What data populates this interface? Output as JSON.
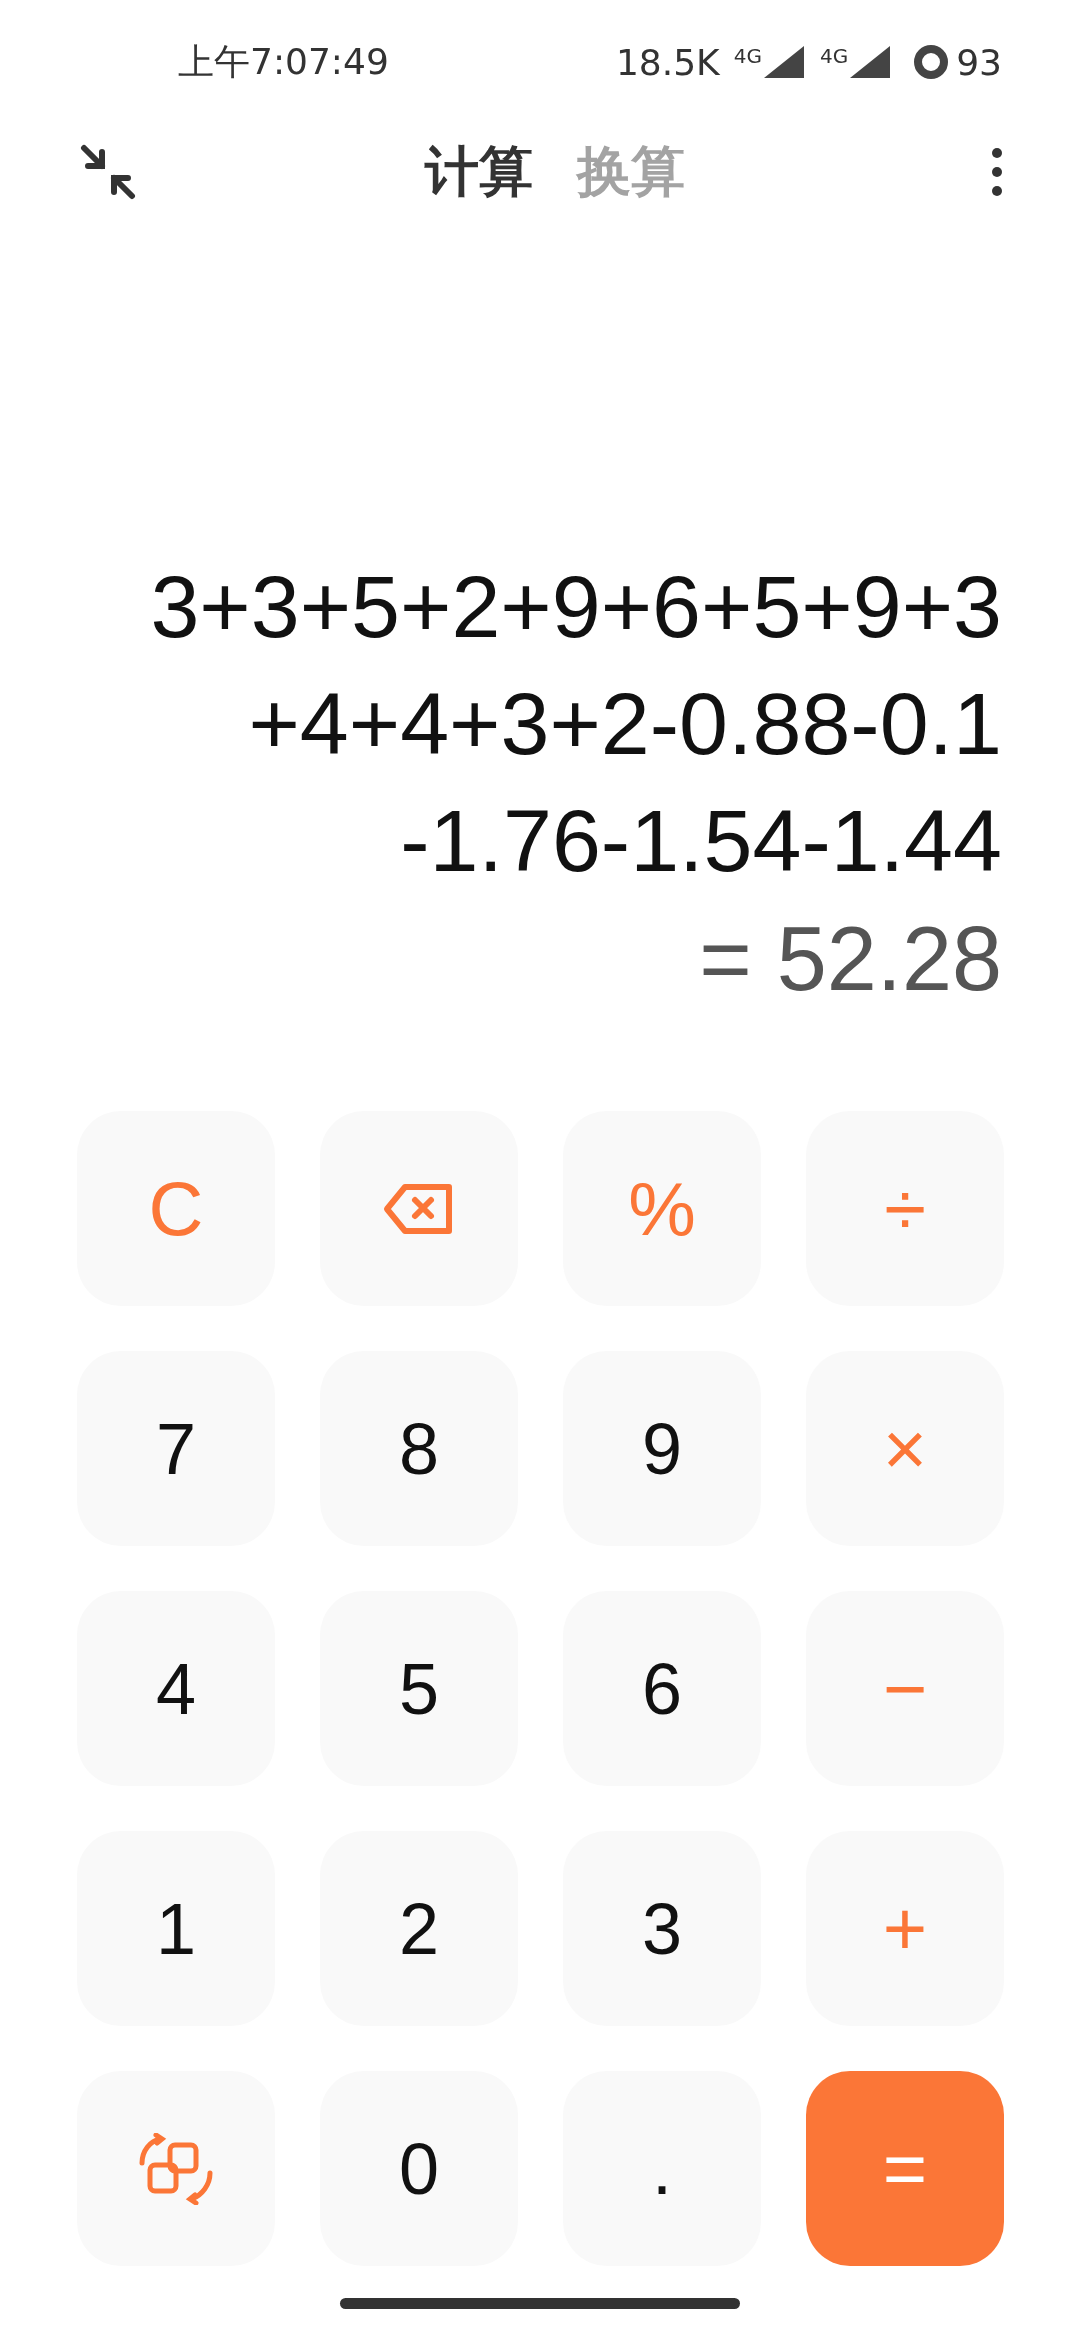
{
  "status_bar": {
    "time": "上午7:07:49",
    "speed": "18.5K",
    "signals": [
      {
        "label": "4G"
      },
      {
        "label": "4G"
      }
    ],
    "battery": "93"
  },
  "tabs": [
    {
      "label": "计算",
      "selected": true
    },
    {
      "label": "换算",
      "selected": false
    }
  ],
  "expression": [
    "3+3+5+2+9+6+5+9+3",
    "+4+4+3+2-0.88-0.1",
    "-1.76-1.54-1.44"
  ],
  "result": "= 52.28",
  "keys": [
    {
      "kind": "clear",
      "label": "C"
    },
    {
      "kind": "backspace"
    },
    {
      "kind": "operator",
      "label": "%"
    },
    {
      "kind": "operator",
      "label": "÷"
    },
    {
      "kind": "digit",
      "label": "7"
    },
    {
      "kind": "digit",
      "label": "8"
    },
    {
      "kind": "digit",
      "label": "9"
    },
    {
      "kind": "operator",
      "label": "×"
    },
    {
      "kind": "digit",
      "label": "4"
    },
    {
      "kind": "digit",
      "label": "5"
    },
    {
      "kind": "digit",
      "label": "6"
    },
    {
      "kind": "operator",
      "label": "−"
    },
    {
      "kind": "digit",
      "label": "1"
    },
    {
      "kind": "digit",
      "label": "2"
    },
    {
      "kind": "digit",
      "label": "3"
    },
    {
      "kind": "operator",
      "label": "+"
    },
    {
      "kind": "convert"
    },
    {
      "kind": "digit",
      "label": "0"
    },
    {
      "kind": "digit",
      "label": "."
    },
    {
      "kind": "equals",
      "label": "="
    }
  ]
}
